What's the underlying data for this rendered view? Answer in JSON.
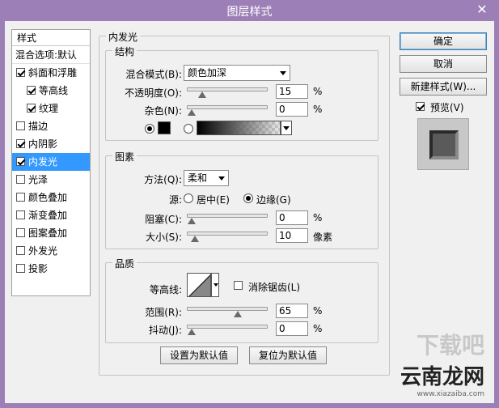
{
  "window": {
    "title": "图层样式",
    "close_glyph": "✕"
  },
  "styles": {
    "header": "样式",
    "blend_options": "混合选项:默认",
    "items": [
      {
        "label": "斜面和浮雕",
        "checked": true,
        "indent": false,
        "selected": false
      },
      {
        "label": "等高线",
        "checked": true,
        "indent": true,
        "selected": false
      },
      {
        "label": "纹理",
        "checked": true,
        "indent": true,
        "selected": false
      },
      {
        "label": "描边",
        "checked": false,
        "indent": false,
        "selected": false
      },
      {
        "label": "内阴影",
        "checked": true,
        "indent": false,
        "selected": false
      },
      {
        "label": "内发光",
        "checked": true,
        "indent": false,
        "selected": true
      },
      {
        "label": "光泽",
        "checked": false,
        "indent": false,
        "selected": false
      },
      {
        "label": "颜色叠加",
        "checked": false,
        "indent": false,
        "selected": false
      },
      {
        "label": "渐变叠加",
        "checked": false,
        "indent": false,
        "selected": false
      },
      {
        "label": "图案叠加",
        "checked": false,
        "indent": false,
        "selected": false
      },
      {
        "label": "外发光",
        "checked": false,
        "indent": false,
        "selected": false
      },
      {
        "label": "投影",
        "checked": false,
        "indent": false,
        "selected": false
      }
    ]
  },
  "panel": {
    "title": "内发光",
    "structure": {
      "title": "结构",
      "blend_mode_label": "混合模式(B):",
      "blend_mode_value": "颜色加深",
      "opacity_label": "不透明度(O):",
      "opacity_value": "15",
      "opacity_unit": "%",
      "opacity_level": 0.15,
      "noise_label": "杂色(N):",
      "noise_value": "0",
      "noise_unit": "%",
      "noise_level": 0,
      "color_swatch": "#000000",
      "color_selected": true,
      "gradient_selected": false
    },
    "elements": {
      "title": "图素",
      "method_label": "方法(Q):",
      "method_value": "柔和",
      "source_label": "源:",
      "source_center": "居中(E)",
      "source_edge": "边缘(G)",
      "source_selected": "edge",
      "choke_label": "阻塞(C):",
      "choke_value": "0",
      "choke_unit": "%",
      "choke_level": 0,
      "size_label": "大小(S):",
      "size_value": "10",
      "size_unit": "像素",
      "size_level": 0.04
    },
    "quality": {
      "title": "品质",
      "contour_label": "等高线:",
      "antialias_label": "消除锯齿(L)",
      "antialias_checked": false,
      "range_label": "范围(R):",
      "range_value": "65",
      "range_unit": "%",
      "range_level": 0.65,
      "jitter_label": "抖动(J):",
      "jitter_value": "0",
      "jitter_unit": "%",
      "jitter_level": 0
    },
    "make_default": "设置为默认值",
    "reset_default": "复位为默认值"
  },
  "buttons": {
    "ok": "确定",
    "cancel": "取消",
    "new_style": "新建样式(W)...",
    "preview_label": "预览(V)",
    "preview_checked": true
  },
  "watermark": {
    "logo": "下载吧",
    "brand": "云南龙网",
    "url": "www.xiazaiba.com"
  }
}
